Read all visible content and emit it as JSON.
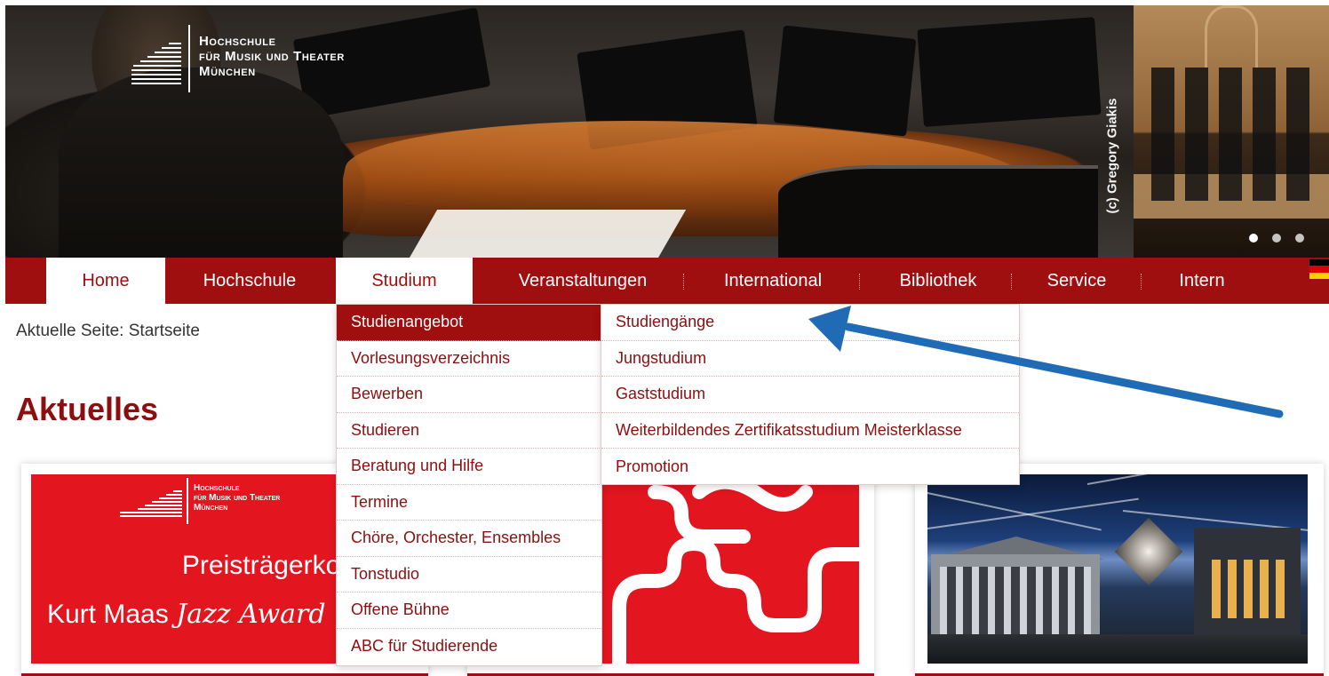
{
  "header": {
    "logo_line1": "Hochschule",
    "logo_line2": "für Musik und Theater",
    "logo_line3": "München",
    "photo_credit": "(c) Gregory Giakis",
    "slider_dots": 3
  },
  "nav": {
    "items": [
      {
        "label": "Home"
      },
      {
        "label": "Hochschule"
      },
      {
        "label": "Studium"
      },
      {
        "label": "Veranstaltungen"
      },
      {
        "label": "International"
      },
      {
        "label": "Bibliothek"
      },
      {
        "label": "Service"
      },
      {
        "label": "Intern"
      }
    ],
    "language_flag": "de-flag-icon"
  },
  "breadcrumb": "Aktuelle Seite: Startseite",
  "page_title": "Aktuelles",
  "dropdown": {
    "primary": [
      {
        "label": "Studienangebot",
        "active": true
      },
      {
        "label": "Vorlesungsverzeichnis"
      },
      {
        "label": "Bewerben"
      },
      {
        "label": "Studieren"
      },
      {
        "label": "Beratung und Hilfe"
      },
      {
        "label": "Termine"
      },
      {
        "label": "Chöre, Orchester, Ensembles"
      },
      {
        "label": "Tonstudio"
      },
      {
        "label": "Offene Bühne"
      },
      {
        "label": "ABC für Studierende"
      }
    ],
    "secondary": [
      {
        "label": "Studiengänge"
      },
      {
        "label": "Jungstudium"
      },
      {
        "label": "Gaststudium"
      },
      {
        "label": "Weiterbildendes Zertifikatsstudium Meisterklasse"
      },
      {
        "label": "Promotion"
      }
    ]
  },
  "cards": {
    "card1": {
      "logo_line1": "Hochschule",
      "logo_line2": "für Musik und Theater",
      "logo_line3": "München",
      "title": "Preisträgerkonzert",
      "subtitle_plain": "Kurt Maas ",
      "subtitle_script": "Jazz Award"
    }
  },
  "colors": {
    "brand_red": "#a00f10",
    "annotation_arrow": "#1f6bb5",
    "card_red": "#e3151f"
  }
}
